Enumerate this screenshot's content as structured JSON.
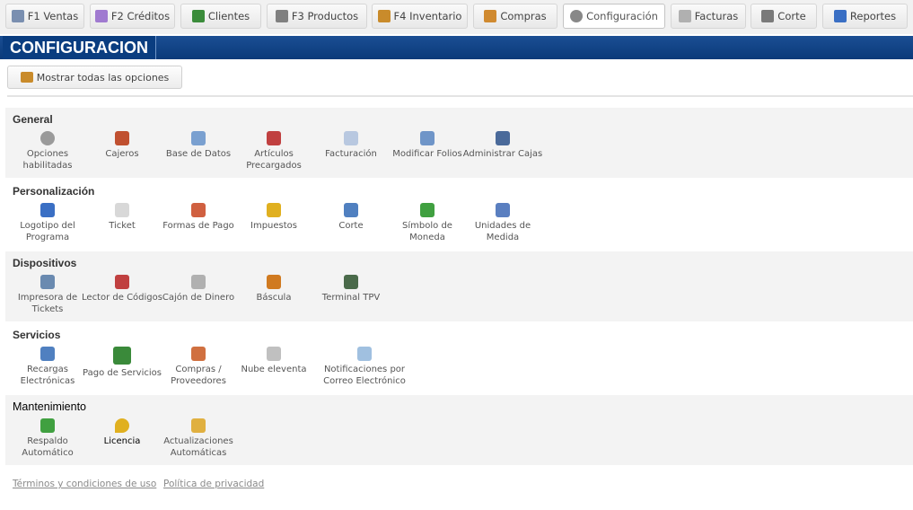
{
  "tabs": [
    {
      "label": "F1 Ventas",
      "icon": "gear-cart-icon",
      "color": "#7a8fb0"
    },
    {
      "label": "F2 Créditos",
      "icon": "credit-icon",
      "color": "#a07ad0"
    },
    {
      "label": "Clientes",
      "icon": "clients-icon",
      "color": "#3b8c3b"
    },
    {
      "label": "F3 Productos",
      "icon": "products-icon",
      "color": "#808080"
    },
    {
      "label": "F4 Inventario",
      "icon": "inventory-icon",
      "color": "#c98b2b"
    },
    {
      "label": "Compras",
      "icon": "purchases-icon",
      "color": "#d08a30"
    },
    {
      "label": "Configuración",
      "icon": "gear-icon",
      "color": "#888888"
    },
    {
      "label": "Facturas",
      "icon": "invoice-icon",
      "color": "#b0b0b0"
    },
    {
      "label": "Corte",
      "icon": "cut-icon",
      "color": "#7a7a7a"
    },
    {
      "label": "Reportes",
      "icon": "chart-icon",
      "color": "#3a6fc4"
    }
  ],
  "header": {
    "title": "CONFIGURACION"
  },
  "show_all": {
    "label": "Mostrar todas las opciones"
  },
  "sections": [
    {
      "title": "General",
      "items": [
        {
          "label": "Opciones habilitadas",
          "icon": "gear-icon",
          "color": "#9a9a9a"
        },
        {
          "label": "Cajeros",
          "icon": "user-icon",
          "color": "#c05030"
        },
        {
          "label": "Base de Datos",
          "icon": "database-icon",
          "color": "#7aa0d0"
        },
        {
          "label": "Artículos Precargados",
          "icon": "articles-icon",
          "color": "#c04040"
        },
        {
          "label": "Facturación",
          "icon": "document-icon",
          "color": "#b8c8e0"
        },
        {
          "label": "Modificar Folios",
          "icon": "folio-icon",
          "color": "#6f95c8"
        },
        {
          "label": "Administrar Cajas",
          "icon": "cashbox-icon",
          "color": "#4a6a9a"
        }
      ]
    },
    {
      "title": "Personalización",
      "items": [
        {
          "label": "Logotipo del Programa",
          "icon": "logo-icon",
          "color": "#3a6fc4"
        },
        {
          "label": "Ticket",
          "icon": "ticket-icon",
          "color": "#d8d8d8"
        },
        {
          "label": "Formas de Pago",
          "icon": "payment-icon",
          "color": "#d06040"
        },
        {
          "label": "Impuestos",
          "icon": "tax-icon",
          "color": "#e0b020"
        },
        {
          "label": "Corte",
          "icon": "cut-icon",
          "color": "#5080c0"
        },
        {
          "label": "Símbolo de Moneda",
          "icon": "currency-icon",
          "color": "#40a040"
        },
        {
          "label": "Unidades de Medida",
          "icon": "units-icon",
          "color": "#5a7fc0"
        }
      ]
    },
    {
      "title": "Dispositivos",
      "items": [
        {
          "label": "Impresora de Tickets",
          "icon": "printer-icon",
          "color": "#6a8ab0"
        },
        {
          "label": "Lector de Códigos",
          "icon": "scanner-icon",
          "color": "#c04040"
        },
        {
          "label": "Cajón de Dinero",
          "icon": "drawer-icon",
          "color": "#b0b0b0"
        },
        {
          "label": "Báscula",
          "icon": "scale-icon",
          "color": "#d07a20"
        },
        {
          "label": "Terminal TPV",
          "icon": "terminal-icon",
          "color": "#4a6a4a"
        }
      ]
    },
    {
      "title": "Servicios",
      "items": [
        {
          "label": "Recargas Electrónicas",
          "icon": "phone-icon",
          "color": "#5080c0"
        },
        {
          "label": "Pago de Servicios",
          "icon": "services-icon",
          "color": "#3a8a3a"
        },
        {
          "label": "Compras / Proveedores",
          "icon": "suppliers-icon",
          "color": "#d07040"
        },
        {
          "label": "Nube eleventa",
          "icon": "cloud-icon",
          "color": "#c0c0c0"
        },
        {
          "label": "Notificaciones por Correo Electrónico",
          "icon": "mail-icon",
          "color": "#a0c0e0"
        }
      ]
    },
    {
      "title": "Mantenimiento",
      "items": [
        {
          "label": "Respaldo Automático",
          "icon": "backup-icon",
          "color": "#40a040"
        },
        {
          "label": "Licencia",
          "icon": "key-icon",
          "color": "#e0b020"
        },
        {
          "label": "Actualizaciones Automáticas",
          "icon": "update-icon",
          "color": "#e0b040"
        }
      ]
    }
  ],
  "footer": {
    "terms": "Términos y condiciones de uso",
    "privacy": "Política de privacidad"
  }
}
